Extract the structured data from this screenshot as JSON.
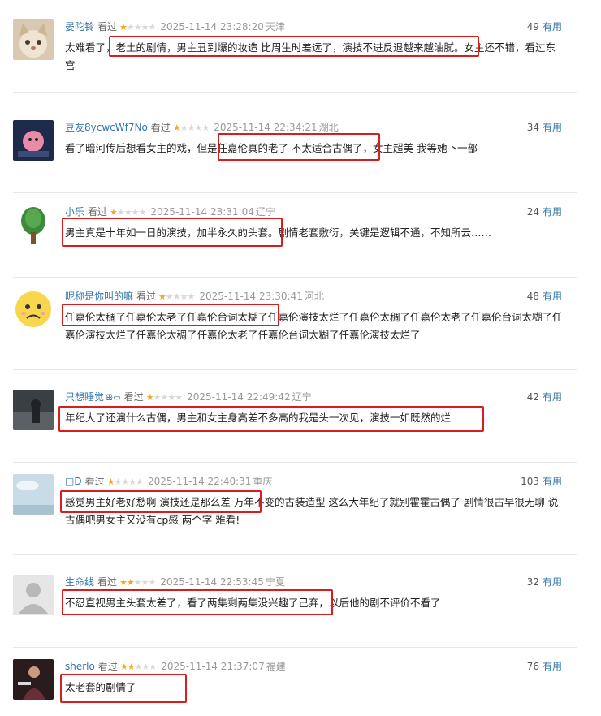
{
  "comments": [
    {
      "author": "晏陀铃",
      "watched": "看过",
      "rating": 1,
      "time": "2025-11-14 23:28:20",
      "location": "天津",
      "votes": "49",
      "votes_label": "有用",
      "text": "太难看了，老土的剧情，男主丑到爆的妆造 比周生时差远了，演技不进反退越来越油腻。女主还不错，看过东宫",
      "avatar_icon": "cat-face-avatar-icon"
    },
    {
      "author": "豆友8ycwcWf7No",
      "watched": "看过",
      "rating": 1,
      "time": "2025-11-14 22:34:21",
      "location": "湖北",
      "votes": "34",
      "votes_label": "有用",
      "text": "看了暗河传后想看女主的戏，但是任嘉伦真的老了 不太适合古偶了，女主超美 我等她下一部",
      "avatar_icon": "pink-character-avatar-icon"
    },
    {
      "author": "小乐",
      "watched": "看过",
      "rating": 1,
      "time": "2025-11-14 23:31:04",
      "location": "辽宁",
      "votes": "24",
      "votes_label": "有用",
      "text": "男主真是十年如一日的演技，加半永久的头套。剧情老套敷衍，关键是逻辑不通，不知所云……",
      "avatar_icon": "tree-avatar-icon"
    },
    {
      "author": "昵称是你叫的嘛",
      "watched": "看过",
      "rating": 1,
      "time": "2025-11-14 23:30:41",
      "location": "河北",
      "votes": "48",
      "votes_label": "有用",
      "text": "任嘉伦太稠了任嘉伦太老了任嘉伦台词太糊了任嘉伦演技太烂了任嘉伦太稠了任嘉伦太老了任嘉伦台词太糊了任嘉伦演技太烂了任嘉伦太稠了任嘉伦太老了任嘉伦台词太糊了任嘉伦演技太烂了",
      "avatar_icon": "worried-emoji-avatar-icon"
    },
    {
      "author": "只想睡觉",
      "badge": "ꕥ▭",
      "watched": "看过",
      "rating": 1,
      "time": "2025-11-14 22:49:42",
      "location": "辽宁",
      "votes": "42",
      "votes_label": "有用",
      "text": "年纪大了还演什么古偶，男主和女主身高差不多高的我是头一次见，演技一如既然的烂",
      "avatar_icon": "dark-photo-avatar-icon"
    },
    {
      "author": "□D",
      "watched": "看过",
      "rating": 1,
      "time": "2025-11-14 22:40:31",
      "location": "重庆",
      "votes": "103",
      "votes_label": "有用",
      "text": "感觉男主好老好愁啊 演技还是那么差 万年不变的古装造型 这么大年纪了就别霍霍古偶了 剧情很古早很无聊 说古偶吧男女主又没有cp感 两个字 难看!",
      "avatar_icon": "sky-photo-avatar-icon"
    },
    {
      "author": "生命线",
      "watched": "看过",
      "rating": 2,
      "time": "2025-11-14 22:53:45",
      "location": "宁夏",
      "votes": "32",
      "votes_label": "有用",
      "text": "不忍直视男主头套太差了，看了两集剩两集没兴趣了己弃，以后他的剧不评价不看了",
      "avatar_icon": "default-user-avatar-icon"
    },
    {
      "author": "sherlo",
      "watched": "看过",
      "rating": 2,
      "time": "2025-11-14 21:37:07",
      "location": "福建",
      "votes": "76",
      "votes_label": "有用",
      "text": "太老套的剧情了",
      "avatar_icon": "person-photo-avatar-icon"
    }
  ],
  "colors": {
    "author": "#3377aa",
    "star_on": "#f5a623",
    "star_off": "#d8d8d8",
    "highlight": "#d71e1e"
  }
}
